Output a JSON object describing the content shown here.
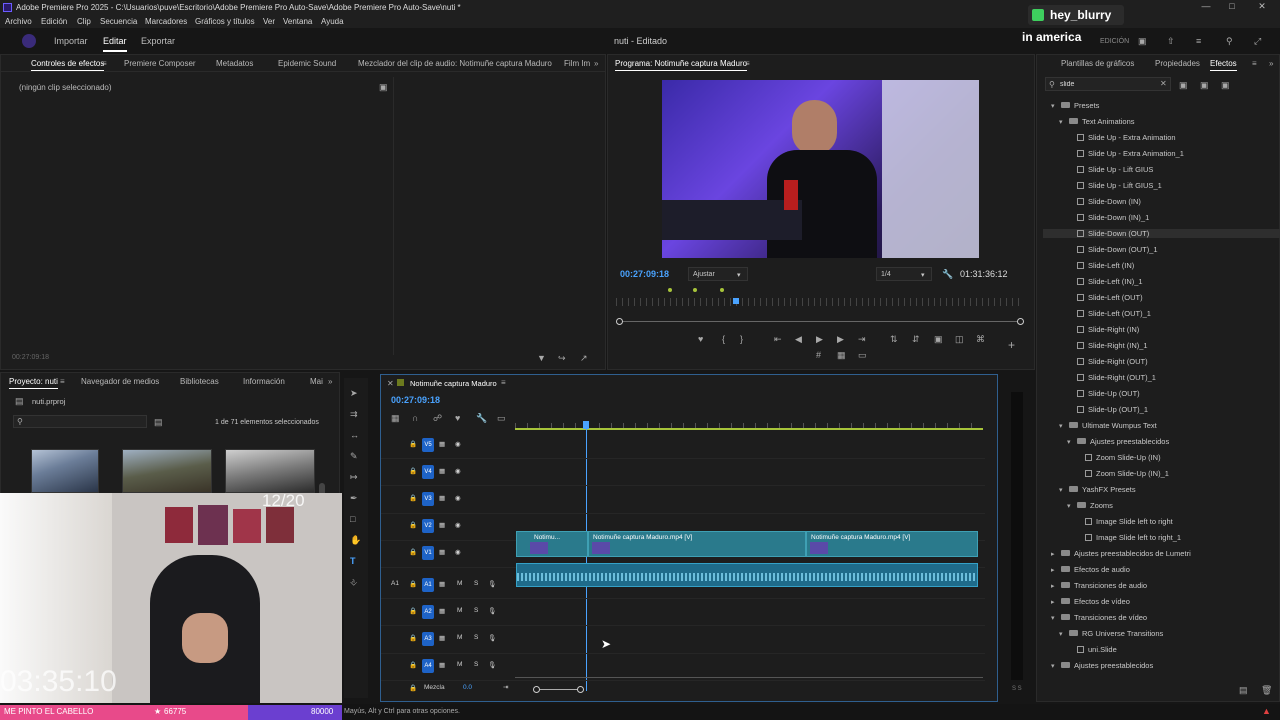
{
  "window": {
    "title": "Adobe Premiere Pro 2025 - C:\\Usuarios\\puve\\Escritorio\\Adobe Premiere Pro Auto-Save\\Adobe Premiere Pro Auto-Save\\nuti *"
  },
  "menu": [
    "Archivo",
    "Edición",
    "Clip",
    "Secuencia",
    "Marcadores",
    "Gráficos y títulos",
    "Ver",
    "Ventana",
    "Ayuda"
  ],
  "header": {
    "tabs": [
      "Importar",
      "Editar",
      "Exportar"
    ],
    "active": "Editar",
    "project_status": "nuti - Editado",
    "workspace": "EDICIÓN"
  },
  "overlay": {
    "username": "hey_blurry",
    "badge_text": "in america",
    "counter": "12/20",
    "clock": "03:35:10",
    "ticker_text": "ME PINTO EL CABELLO",
    "ticker_count": "66775",
    "ticker_goal": "80000"
  },
  "effect_controls": {
    "tabs": [
      "Controles de efectos",
      "Premiere Composer",
      "Metadatos",
      "Epidemic Sound",
      "Mezclador del clip de audio: Notimuñe captura Maduro",
      "Film Im"
    ],
    "empty_message": "(ningún clip seleccionado)",
    "timecode": "00:27:09:18"
  },
  "program_monitor": {
    "title": "Programa: Notimuñe captura Maduro",
    "timecode": "00:27:09:18",
    "fit": "Ajustar",
    "resolution": "1/4",
    "duration": "01:31:36:12"
  },
  "project_panel": {
    "tabs": [
      "Proyecto: nuti",
      "Navegador de medios",
      "Bibliotecas",
      "Información",
      "Mai"
    ],
    "file": "nuti.prproj",
    "selection": "1 de 71 elementos seleccionados"
  },
  "timeline": {
    "sequence_name": "Notimuñe captura Maduro",
    "timecode": "00:27:09:18",
    "video_tracks": [
      "V5",
      "V4",
      "V3",
      "V2",
      "V1"
    ],
    "audio_tracks": [
      "A1",
      "A2",
      "A3",
      "A4"
    ],
    "clip_short": "Notimu...",
    "clip_name": "Notimuñe captura Maduro.mp4 [V]",
    "mix_label": "Mezcla",
    "mix_value": "0.0"
  },
  "effects_panel": {
    "tabs": [
      "Plantillas de gráficos",
      "Propiedades",
      "Efectos"
    ],
    "search_value": "slide",
    "tree": [
      {
        "label": "Presets",
        "level": 0,
        "kind": "folder",
        "open": true
      },
      {
        "label": "Text Animations",
        "level": 1,
        "kind": "folder",
        "open": true
      },
      {
        "label": "Slide Up - Extra Animation",
        "level": 2,
        "kind": "preset"
      },
      {
        "label": "Slide Up - Extra Animation_1",
        "level": 2,
        "kind": "preset"
      },
      {
        "label": "Slide Up - Lift GIUS",
        "level": 2,
        "kind": "preset"
      },
      {
        "label": "Slide Up - Lift GIUS_1",
        "level": 2,
        "kind": "preset"
      },
      {
        "label": "Slide-Down (IN)",
        "level": 2,
        "kind": "preset"
      },
      {
        "label": "Slide-Down (IN)_1",
        "level": 2,
        "kind": "preset"
      },
      {
        "label": "Slide-Down (OUT)",
        "level": 2,
        "kind": "preset",
        "selected": true
      },
      {
        "label": "Slide-Down (OUT)_1",
        "level": 2,
        "kind": "preset"
      },
      {
        "label": "Slide-Left (IN)",
        "level": 2,
        "kind": "preset"
      },
      {
        "label": "Slide-Left (IN)_1",
        "level": 2,
        "kind": "preset"
      },
      {
        "label": "Slide-Left (OUT)",
        "level": 2,
        "kind": "preset"
      },
      {
        "label": "Slide-Left (OUT)_1",
        "level": 2,
        "kind": "preset"
      },
      {
        "label": "Slide-Right (IN)",
        "level": 2,
        "kind": "preset"
      },
      {
        "label": "Slide-Right (IN)_1",
        "level": 2,
        "kind": "preset"
      },
      {
        "label": "Slide-Right (OUT)",
        "level": 2,
        "kind": "preset"
      },
      {
        "label": "Slide-Right (OUT)_1",
        "level": 2,
        "kind": "preset"
      },
      {
        "label": "Slide-Up (OUT)",
        "level": 2,
        "kind": "preset"
      },
      {
        "label": "Slide-Up (OUT)_1",
        "level": 2,
        "kind": "preset"
      },
      {
        "label": "Ultimate Wumpus Text",
        "level": 1,
        "kind": "folder",
        "open": true
      },
      {
        "label": "Ajustes preestablecidos",
        "level": 2,
        "kind": "folder",
        "open": true
      },
      {
        "label": "Zoom Slide-Up (IN)",
        "level": 3,
        "kind": "preset"
      },
      {
        "label": "Zoom Slide-Up (IN)_1",
        "level": 3,
        "kind": "preset"
      },
      {
        "label": "YashFX Presets",
        "level": 1,
        "kind": "folder",
        "open": true
      },
      {
        "label": "Zooms",
        "level": 2,
        "kind": "folder",
        "open": true
      },
      {
        "label": "Image Slide left to right",
        "level": 3,
        "kind": "preset"
      },
      {
        "label": "Image Slide left to right_1",
        "level": 3,
        "kind": "preset"
      },
      {
        "label": "Ajustes preestablecidos de Lumetri",
        "level": 0,
        "kind": "folder",
        "open": false
      },
      {
        "label": "Efectos de audio",
        "level": 0,
        "kind": "folder",
        "open": false
      },
      {
        "label": "Transiciones de audio",
        "level": 0,
        "kind": "folder",
        "open": false
      },
      {
        "label": "Efectos de vídeo",
        "level": 0,
        "kind": "folder",
        "open": false
      },
      {
        "label": "Transiciones de vídeo",
        "level": 0,
        "kind": "folder",
        "open": true
      },
      {
        "label": "RG Universe Transitions",
        "level": 1,
        "kind": "folder",
        "open": true
      },
      {
        "label": "uni.Slide",
        "level": 2,
        "kind": "effect"
      },
      {
        "label": "Ajustes preestablecidos",
        "level": 0,
        "kind": "folder",
        "open": true
      }
    ]
  },
  "status_bar": {
    "text": "Mayús, Alt y Ctrl para otras opciones."
  },
  "meters": {
    "label": "S S"
  },
  "colors": {
    "accent": "#2d8ceb",
    "timecode": "#4aa3ff",
    "track_badge": "#1e63c7",
    "clip_video": "#2a7a8c",
    "clip_audio": "#1f6b8a",
    "overlay_green": "#3ecf5e",
    "ticker_pink": "#e84a8a",
    "ticker_purple": "#6b3fd0"
  }
}
